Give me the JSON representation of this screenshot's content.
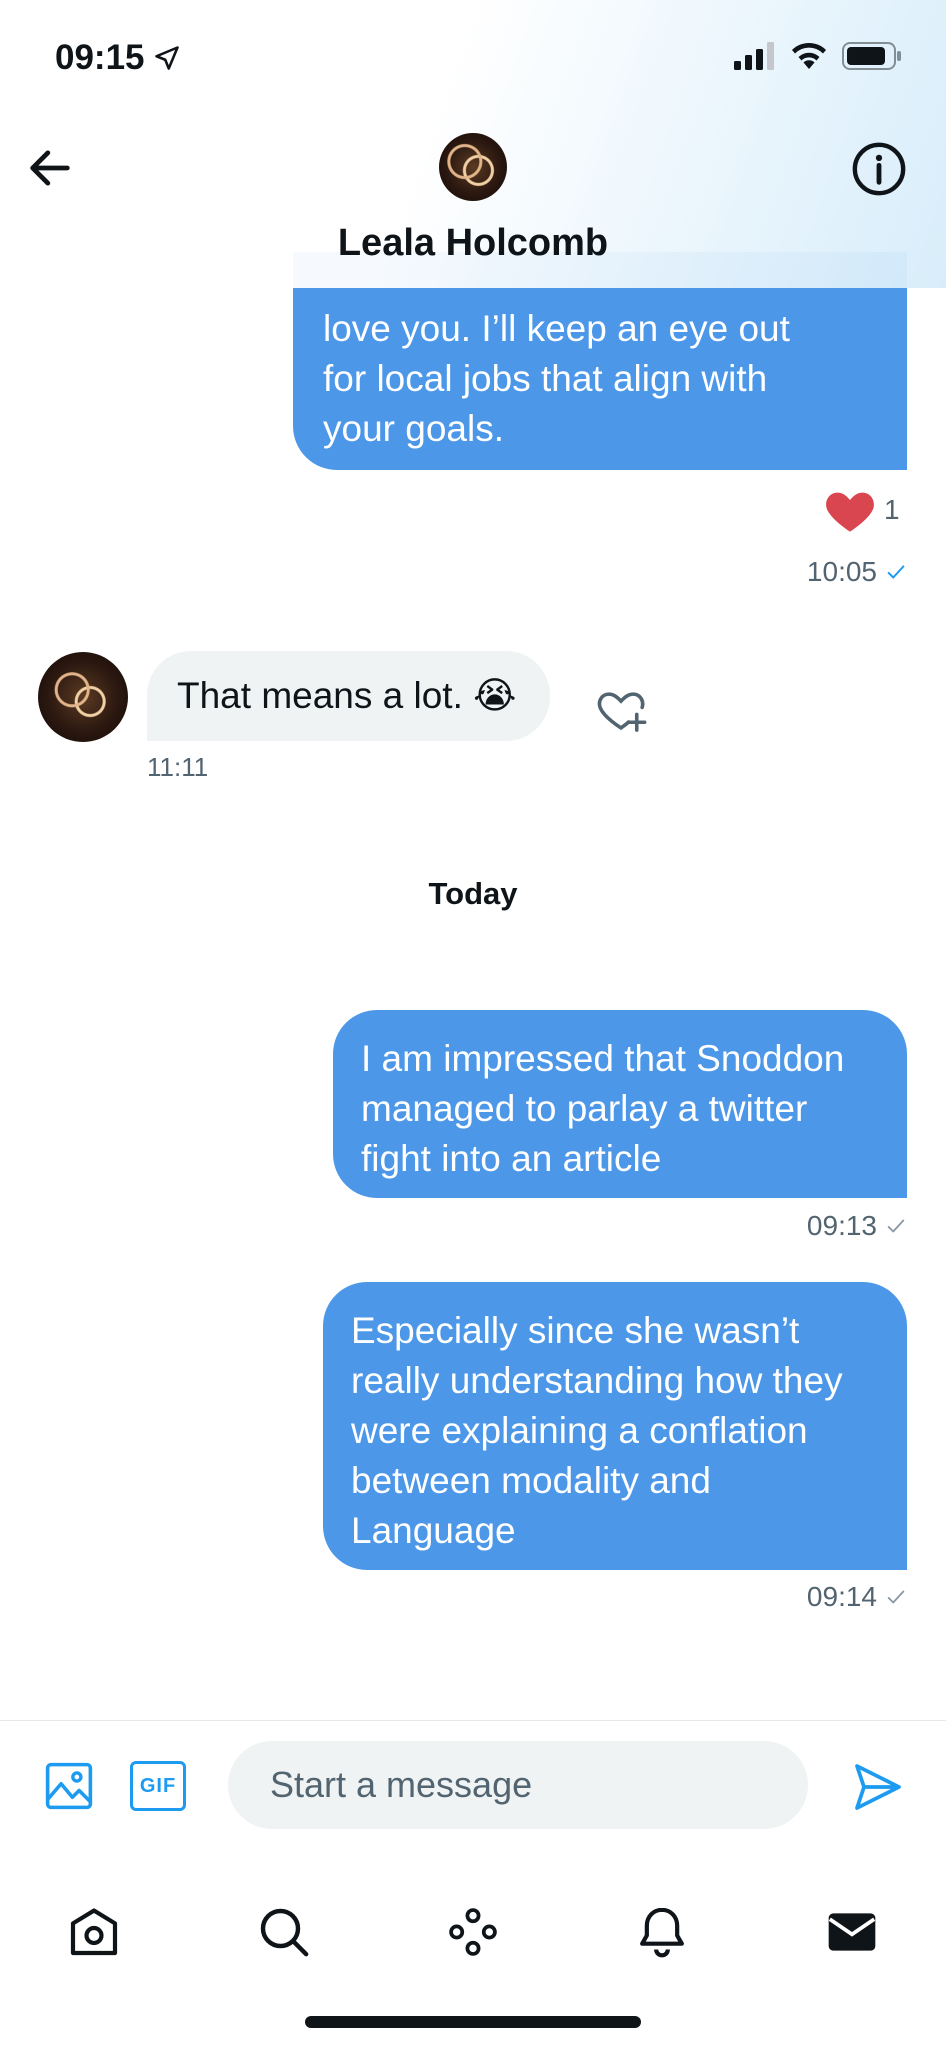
{
  "status_bar": {
    "time": "09:15"
  },
  "header": {
    "contact_name": "Leala Holcomb"
  },
  "messages": [
    {
      "direction": "outgoing",
      "text": "love you. I’ll keep an eye out\nfor local jobs that align with\nyour goals.",
      "reaction_count": "1",
      "time": "10:05"
    },
    {
      "direction": "incoming",
      "text": "That means a lot. 😭",
      "time": "11:11"
    },
    {
      "direction": "outgoing",
      "text": "I am impressed that Snoddon\nmanaged to parlay a twitter\nfight into an article",
      "time": "09:13"
    },
    {
      "direction": "outgoing",
      "text": "Especially since she wasn’t\nreally understanding how they\nwere explaining a conflation\nbetween modality and\nLanguage",
      "time": "09:14"
    }
  ],
  "day_separator": "Today",
  "composer": {
    "placeholder": "Start a message",
    "gif_label": "GIF"
  },
  "colors": {
    "accent": "#1d9bf0",
    "outgoing_bubble": "#4c97e8",
    "incoming_bubble": "#eff3f4",
    "reaction": "#e0245e"
  },
  "tabs": [
    {
      "name": "home",
      "icon": "home-icon"
    },
    {
      "name": "search",
      "icon": "search-icon"
    },
    {
      "name": "spaces",
      "icon": "spaces-icon"
    },
    {
      "name": "notifications",
      "icon": "bell-icon"
    },
    {
      "name": "messages",
      "icon": "mail-icon"
    }
  ]
}
